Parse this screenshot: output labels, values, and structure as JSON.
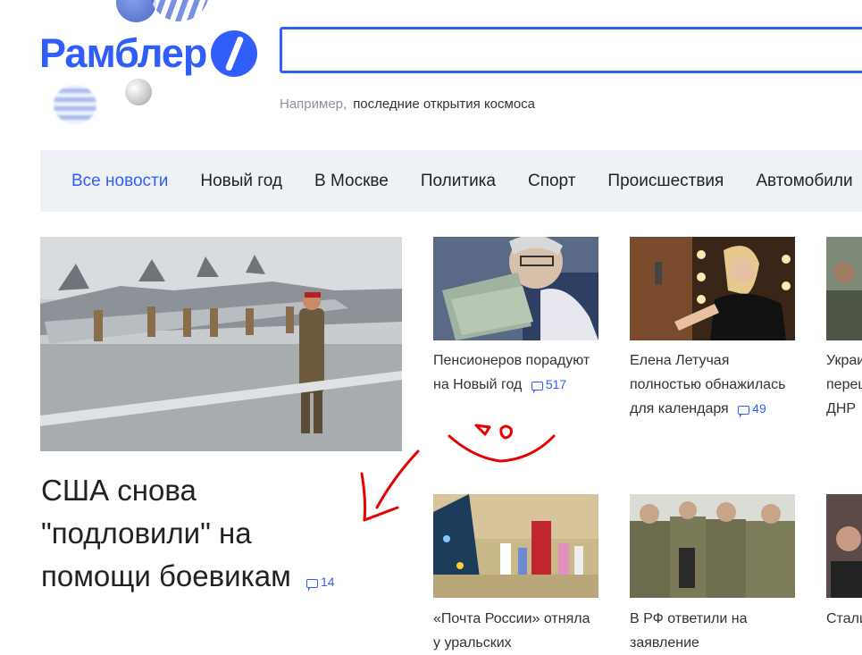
{
  "header": {
    "logo_text": "Рамблер",
    "search": {
      "value": "",
      "placeholder": ""
    },
    "hint_prefix": "Например,",
    "hint_example": "последние открытия космоса"
  },
  "nav": {
    "items": [
      "Все новости",
      "Новый год",
      "В Москве",
      "Политика",
      "Спорт",
      "Происшествия",
      "Автомобили"
    ],
    "active_index": 0
  },
  "lead": {
    "title": "США снова \"подловили\" на помощи боевикам",
    "comments": "14"
  },
  "cards": [
    {
      "title": "Пенсионеров порадуют на Новый год",
      "comments": "517"
    },
    {
      "title": "Елена Летучая полностью обнажилась для календаря",
      "comments": "49"
    },
    {
      "title": "Украинские военные перешли на сторону ДНР",
      "comments": ""
    },
    {
      "title": "«Почта России» отняла у уральских",
      "comments": ""
    },
    {
      "title": "В РФ ответили на заявление",
      "comments": ""
    },
    {
      "title": "Сталин зарплаты",
      "comments": ""
    }
  ],
  "colors": {
    "accent": "#315efb",
    "nav_bg": "#eef1f5",
    "annotation": "#e60000"
  }
}
